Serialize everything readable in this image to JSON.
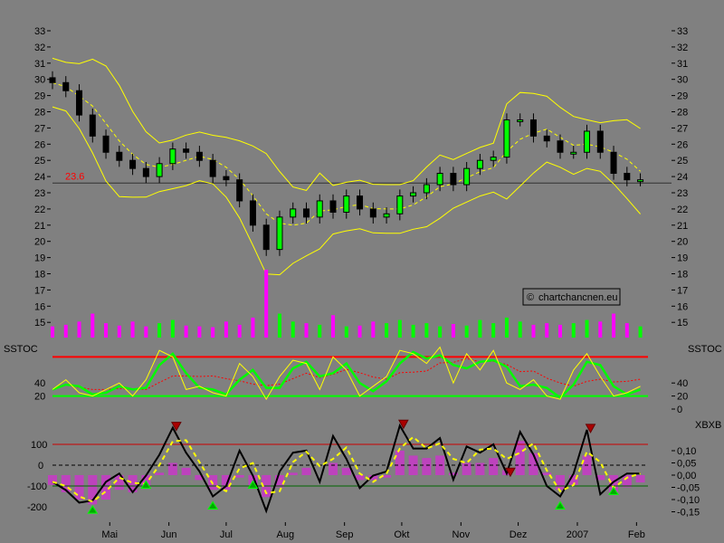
{
  "chart_data": [
    {
      "type": "candlestick",
      "panel": "price",
      "x": [
        "2006-04-01",
        "2006-04-08",
        "2006-04-15",
        "2006-04-22",
        "2006-04-29",
        "2006-05-06",
        "2006-05-13",
        "2006-05-20",
        "2006-05-27",
        "2006-06-03",
        "2006-06-10",
        "2006-06-17",
        "2006-06-24",
        "2006-07-01",
        "2006-07-08",
        "2006-07-15",
        "2006-07-22",
        "2006-07-29",
        "2006-08-05",
        "2006-08-12",
        "2006-08-19",
        "2006-08-26",
        "2006-09-02",
        "2006-09-09",
        "2006-09-16",
        "2006-09-23",
        "2006-09-30",
        "2006-10-07",
        "2006-10-14",
        "2006-10-21",
        "2006-10-28",
        "2006-11-04",
        "2006-11-11",
        "2006-11-18",
        "2006-11-25",
        "2006-12-02",
        "2006-12-09",
        "2006-12-16",
        "2006-12-23",
        "2006-12-30",
        "2007-01-06",
        "2007-01-13",
        "2007-01-20",
        "2007-01-27",
        "2007-02-03"
      ],
      "close": [
        29.8,
        29.3,
        27.8,
        26.5,
        25.5,
        25.0,
        24.5,
        24.0,
        24.8,
        25.7,
        25.5,
        25.0,
        24.0,
        23.8,
        22.5,
        21.0,
        19.5,
        21.5,
        22.0,
        21.5,
        22.5,
        21.8,
        22.8,
        22.0,
        21.5,
        21.7,
        22.8,
        23.0,
        23.5,
        24.2,
        23.5,
        24.5,
        25.0,
        25.2,
        27.5,
        27.5,
        26.5,
        26.2,
        25.5,
        25.5,
        26.8,
        25.5,
        24.2,
        23.8,
        23.8
      ],
      "volume": [
        14,
        16,
        20,
        30,
        18,
        15,
        20,
        14,
        18,
        22,
        15,
        14,
        13,
        20,
        16,
        25,
        85,
        30,
        20,
        18,
        16,
        28,
        14,
        15,
        20,
        18,
        22,
        16,
        18,
        14,
        17,
        15,
        22,
        18,
        25,
        20,
        16,
        18,
        16,
        18,
        22,
        20,
        30,
        18,
        14
      ],
      "horizontal_line": {
        "value": 23.6,
        "label": "23.6"
      },
      "y_ticks": [
        15,
        16,
        17,
        18,
        19,
        20,
        21,
        22,
        23,
        24,
        25,
        26,
        27,
        28,
        29,
        30,
        31,
        32,
        33
      ],
      "ylim": [
        15,
        33
      ],
      "indicators": [
        "bollinger-bands",
        "moving-average"
      ],
      "watermark": "chartchancnen.eu"
    },
    {
      "type": "line",
      "panel": "SSTOC",
      "title": "SSTOC",
      "x_ref": "price.x",
      "values": [
        30,
        45,
        25,
        20,
        30,
        40,
        20,
        45,
        90,
        80,
        30,
        35,
        25,
        20,
        70,
        50,
        15,
        50,
        75,
        70,
        30,
        80,
        60,
        20,
        35,
        50,
        90,
        85,
        70,
        95,
        40,
        85,
        60,
        90,
        40,
        30,
        45,
        20,
        15,
        60,
        85,
        50,
        20,
        25,
        35
      ],
      "levels": {
        "upper": 80,
        "lower": 20
      },
      "y_ticks": [
        0,
        20,
        40
      ],
      "ylim": [
        0,
        100
      ]
    },
    {
      "type": "line",
      "panel": "XBXB",
      "title": "XBXB",
      "values": [
        -80,
        -120,
        -180,
        -170,
        -80,
        -40,
        -130,
        -50,
        50,
        180,
        60,
        -30,
        -150,
        -100,
        70,
        -50,
        -220,
        -30,
        60,
        70,
        -80,
        140,
        30,
        -110,
        -50,
        -30,
        190,
        80,
        80,
        130,
        -70,
        90,
        60,
        100,
        -40,
        160,
        50,
        -100,
        -150,
        -40,
        170,
        -140,
        -80,
        -40,
        -40
      ],
      "histogram": [
        -0.04,
        -0.07,
        -0.1,
        -0.12,
        -0.1,
        -0.06,
        -0.07,
        -0.05,
        0.01,
        0.05,
        0.03,
        -0.02,
        -0.06,
        -0.06,
        -0.01,
        -0.04,
        -0.09,
        -0.05,
        0.01,
        0.03,
        0.0,
        0.05,
        0.03,
        -0.02,
        -0.02,
        -0.01,
        0.1,
        0.08,
        0.07,
        0.08,
        0.01,
        0.05,
        0.05,
        0.07,
        0.02,
        0.14,
        0.09,
        0.01,
        -0.06,
        -0.04,
        0.08,
        -0.02,
        -0.07,
        -0.05,
        -0.03
      ],
      "buy_signals": [
        "2006-04-22",
        "2006-05-20",
        "2006-06-24",
        "2006-07-15",
        "2006-12-23",
        "2007-01-20"
      ],
      "sell_signals": [
        "2006-06-03",
        "2006-09-30",
        "2006-11-25",
        "2007-01-06"
      ],
      "levels": {
        "upper": 100,
        "zero": 0,
        "lower": -100
      },
      "y_ticks_left": [
        -200,
        -100,
        0,
        100
      ],
      "y_ticks_right": [
        "-0,15",
        "-0,10",
        "-0,05",
        "0,00",
        "0,05",
        "0,10"
      ],
      "ylim": [
        -250,
        220
      ]
    }
  ],
  "x_axis": {
    "ticks": [
      {
        "label": "Mai",
        "date": "2006-05-01"
      },
      {
        "label": "Jun",
        "date": "2006-06-01"
      },
      {
        "label": "Jul",
        "date": "2006-07-01"
      },
      {
        "label": "Aug",
        "date": "2006-08-01"
      },
      {
        "label": "Sep",
        "date": "2006-09-01"
      },
      {
        "label": "Okt",
        "date": "2006-10-01"
      },
      {
        "label": "Nov",
        "date": "2006-11-01"
      },
      {
        "label": "Dez",
        "date": "2006-12-01"
      },
      {
        "label": "2007",
        "date": "2007-01-01"
      },
      {
        "label": "Feb",
        "date": "2007-02-01"
      }
    ]
  },
  "colors": {
    "background": "#808080",
    "candle_up": "#00ff00",
    "candle_down": "#ff00ff",
    "bands": "#ffff00",
    "stoch_fast": "#ffff00",
    "stoch_slow": "#00ff00",
    "stoch_signal": "#ff0000",
    "upper_level": "#ff0000",
    "lower_level": "#00ff00",
    "xbxb_line": "#000000",
    "xbxb_hist": "#cc33cc"
  },
  "labels": {
    "sstoc_left": "SSTOC",
    "sstoc_right": "SSTOC",
    "xbxb_right": "XBXB",
    "watermark": "chartchancnen.eu"
  }
}
